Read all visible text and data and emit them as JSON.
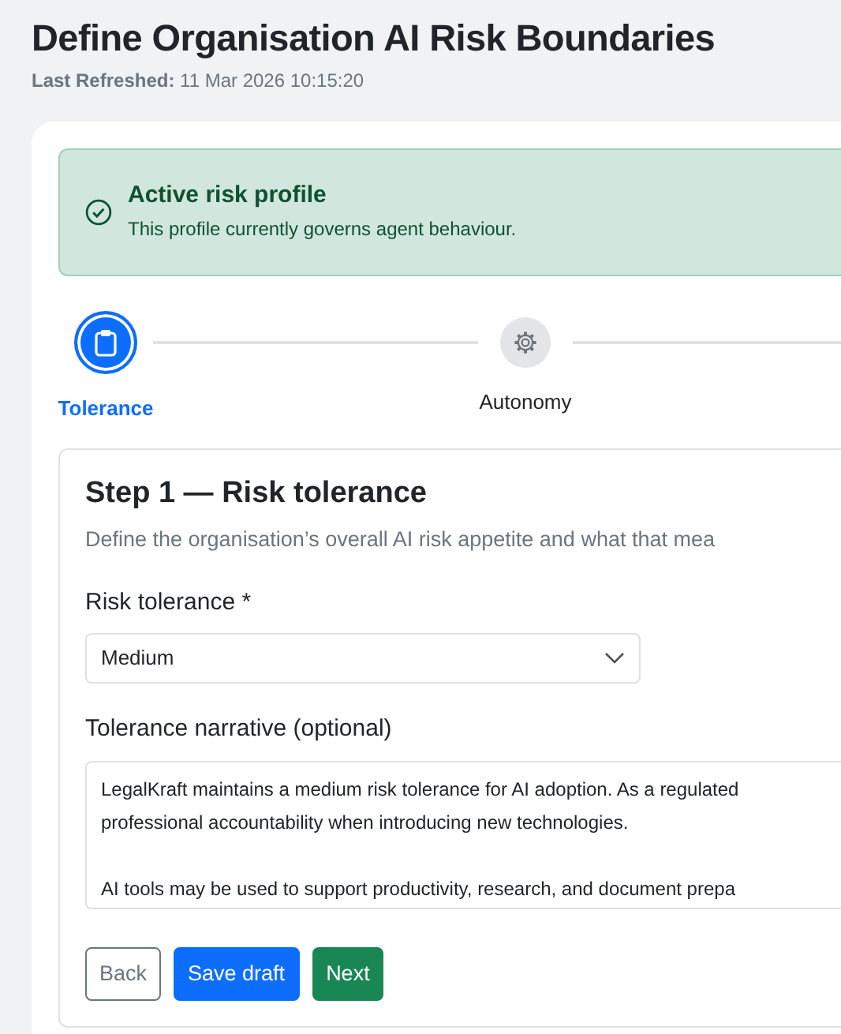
{
  "page": {
    "title": "Define Organisation AI Risk Boundaries",
    "refreshed_label": "Last Refreshed:",
    "refreshed_value": "11 Mar 2026 10:15:20"
  },
  "alert": {
    "title": "Active risk profile",
    "text": "This profile currently governs agent behaviour."
  },
  "steps": [
    {
      "label": "Tolerance",
      "kind": "clipboard",
      "selected": true
    },
    {
      "label": "Autonomy",
      "kind": "gear",
      "selected": false
    }
  ],
  "form": {
    "heading": "Step 1 — Risk tolerance",
    "description": "Define the organisation’s overall AI risk appetite and what that mea",
    "select_label": "Risk tolerance *",
    "select_value": "Medium",
    "narrative_label": "Tolerance narrative (optional)",
    "narrative_value": "LegalKraft maintains a medium risk tolerance for AI adoption. As a regulated\nprofessional accountability when introducing new technologies.\n\nAI tools may be used to support productivity, research, and document prepa"
  },
  "buttons": [
    {
      "label": "Back",
      "kind": "back"
    },
    {
      "label": "Save draft",
      "kind": "save"
    },
    {
      "label": "Next",
      "kind": "next"
    }
  ]
}
